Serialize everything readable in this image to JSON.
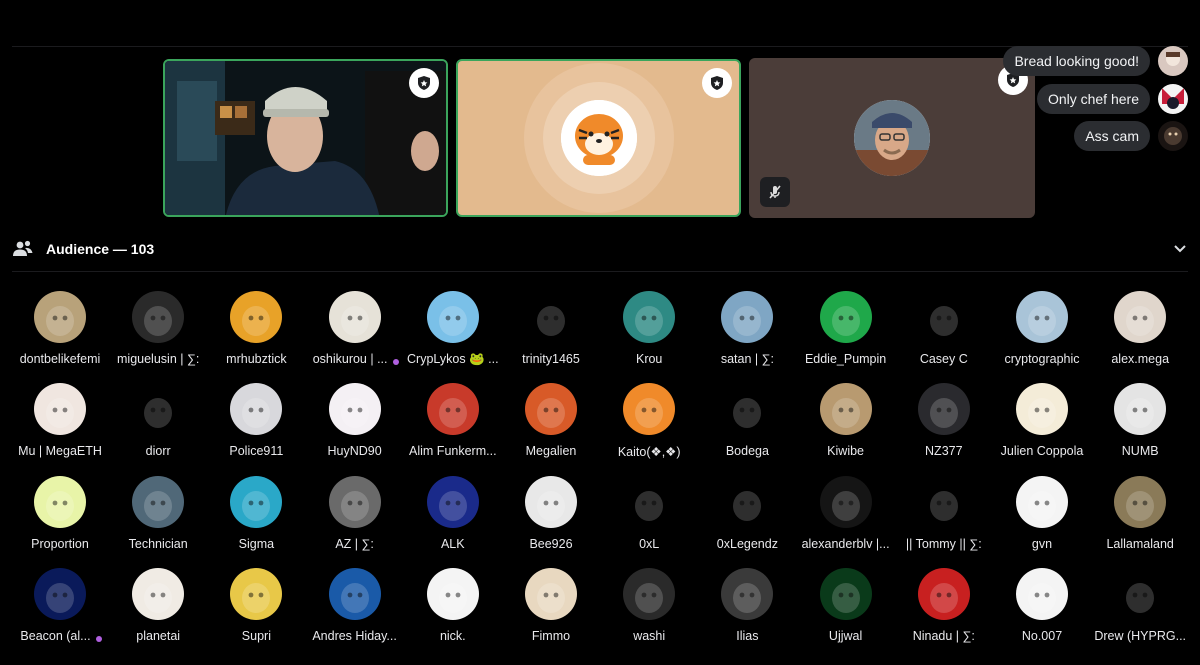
{
  "stage": {
    "tiles": [
      {
        "id": "tile1",
        "speaking": true,
        "colors": [
          "#0c1418",
          "#2a4a58",
          "#cfd8d8"
        ]
      },
      {
        "id": "tile2",
        "speaking": true,
        "colors": [
          "#e3ba8e"
        ]
      },
      {
        "id": "tile3",
        "speaking": false,
        "muted": true,
        "colors": [
          "#4b3d39"
        ]
      }
    ]
  },
  "chat": [
    {
      "text": "Bread looking good!",
      "avatar_color": "#d9c8c0"
    },
    {
      "text": "Only chef here",
      "avatar_color": "#c81e3a"
    },
    {
      "text": "Ass cam",
      "avatar_color": "#4a3a30"
    }
  ],
  "audience": {
    "label": "Audience — 103",
    "members": [
      {
        "name": "dontbelikefemi",
        "color": "#b8a27a"
      },
      {
        "name": "miguelusin | ∑:",
        "color": "#2a2a2a"
      },
      {
        "name": "mrhubztick",
        "color": "#e8a228"
      },
      {
        "name": "oshikurou | ...",
        "color": "#e6e2d8",
        "dot": true
      },
      {
        "name": "CrypLykos 🐸 ...",
        "color": "#7ac0e8"
      },
      {
        "name": "trinity1465",
        "color": "#000000"
      },
      {
        "name": "Krou",
        "color": "#2e8a84"
      },
      {
        "name": "satan | ∑:",
        "color": "#7fa6c4"
      },
      {
        "name": "Eddie_Pumpin",
        "color": "#1fa84a"
      },
      {
        "name": "Casey C",
        "color": "#000000"
      },
      {
        "name": "cryptographic",
        "color": "#a9c4d8"
      },
      {
        "name": "alex.mega",
        "color": "#e0d6cc"
      },
      {
        "name": "Mu | MegaETH",
        "color": "#f0e6e0"
      },
      {
        "name": "diorr",
        "color": "#000000"
      },
      {
        "name": "Police911",
        "color": "#d8d8dc"
      },
      {
        "name": "HuyND90",
        "color": "#f4f0f4"
      },
      {
        "name": "Alim Funkerm...",
        "color": "#c83a2a"
      },
      {
        "name": "Megalien",
        "color": "#d85a28"
      },
      {
        "name": "Kaito(❖,❖)",
        "color": "#f08a2a"
      },
      {
        "name": "Bodega",
        "color": "#000000"
      },
      {
        "name": "Kiwibe",
        "color": "#b89a70"
      },
      {
        "name": "NZ377",
        "color": "#2a2a2e"
      },
      {
        "name": "Julien Coppola",
        "color": "#f4ecd8"
      },
      {
        "name": "NUMB",
        "color": "#e4e4e4"
      },
      {
        "name": "Proportion",
        "color": "#e8f4a8"
      },
      {
        "name": "Technician",
        "color": "#506878"
      },
      {
        "name": "Sigma",
        "color": "#2aa8c8"
      },
      {
        "name": "AZ | ∑:",
        "color": "#6a6a6a"
      },
      {
        "name": "ALK",
        "color": "#1a2a8a"
      },
      {
        "name": "Bee926",
        "color": "#e8e8e8"
      },
      {
        "name": "0xL",
        "color": "#000000"
      },
      {
        "name": "0xLegendz",
        "color": "#000000"
      },
      {
        "name": "alexanderblv |...",
        "color": "#151515"
      },
      {
        "name": "|| Tommy || ∑:",
        "color": "#000000"
      },
      {
        "name": "gvn",
        "color": "#f4f4f4"
      },
      {
        "name": "Lallamaland",
        "color": "#8a7a58"
      },
      {
        "name": "Beacon (al...",
        "color": "#0a1a5a",
        "dot": true
      },
      {
        "name": "planetai",
        "color": "#f0ebe4"
      },
      {
        "name": "Supri",
        "color": "#e8c848"
      },
      {
        "name": "Andres Hiday...",
        "color": "#1a5aa8"
      },
      {
        "name": "nick.",
        "color": "#f4f4f4"
      },
      {
        "name": "Fimmo",
        "color": "#e8d8c0"
      },
      {
        "name": "washi",
        "color": "#2a2a2a"
      },
      {
        "name": "Ilias",
        "color": "#3a3a3a"
      },
      {
        "name": "Ujjwal",
        "color": "#0a3a1a"
      },
      {
        "name": "Ninadu | ∑:",
        "color": "#c82020"
      },
      {
        "name": "No.007",
        "color": "#f4f4f4"
      },
      {
        "name": "Drew (HYPRG...",
        "color": "#000000"
      }
    ]
  }
}
